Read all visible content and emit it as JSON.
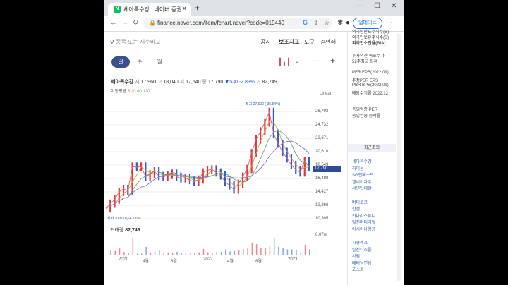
{
  "browser": {
    "tab_title": "세아특수강 : 네이버 증권",
    "url": "finance.naver.com/item/fchart.naver?code=019440",
    "update_label": "업데이트"
  },
  "chart_ui": {
    "search_placeholder": "종목 또는 지수비교",
    "menu": [
      "공시",
      "보조지표",
      "도구",
      "인쇄"
    ],
    "periods": [
      "일",
      "주",
      "월"
    ],
    "quote_name": "세아특수강",
    "quote_open_label": "시",
    "quote_open": "17,960",
    "quote_high_label": "고",
    "quote_high": "18,040",
    "quote_low_label": "저",
    "quote_low": "17,540",
    "quote_close_label": "종",
    "quote_close": "17,790",
    "quote_change": "▼530",
    "quote_pct": "-2.89%",
    "quote_vol_label": "거",
    "quote_vol": "82,749",
    "ma_label": "이동평균",
    "ma_values": [
      "5",
      "20",
      "60",
      "120"
    ],
    "scale": "Linear",
    "high_label": "최고 27,600 (-35.54%)",
    "low_label": "최저 10,800 (64.72%)",
    "current_price": "17,790",
    "volume_label": "거래량",
    "volume_value": "82,749",
    "volume_axis": "6.07m"
  },
  "chart_data": {
    "type": "line",
    "y_ticks": [
      "26,793",
      "24,732",
      "22,671",
      "20,610",
      "18,549",
      "16,488",
      "14,427",
      "12,366",
      "10,305"
    ],
    "x_ticks": [
      "2021",
      "4월",
      "8월",
      "2022",
      "4월",
      "8월",
      "2023"
    ],
    "price_series": [
      10.8,
      11.6,
      12.3,
      13.6,
      14.1,
      13.8,
      17.9,
      17.8,
      17.9,
      16.2,
      16.6,
      17.1,
      16.3,
      16.1,
      16.5,
      16.7,
      16.2,
      15.9,
      16.0,
      15.6,
      15.3,
      15.7,
      16.9,
      17.3,
      17.4,
      16.9,
      16.4,
      15.3,
      14.7,
      14.0,
      15.0,
      16.2,
      17.5,
      20.2,
      22.5,
      23.9,
      25.4,
      27.2,
      23.5,
      21.8,
      20.4,
      19.3,
      18.2,
      17.3,
      16.9,
      18.9,
      17.8
    ]
  },
  "sidebar": {
    "top_items": [
      "외국인한도주식수(B)",
      "외국인보유주식수(B)",
      "외국인소진율(B/A)"
    ],
    "rows1": [
      "투자의견 목표주가",
      "52주최고 최저"
    ],
    "rows2": [
      "PER EPS(2022.09)",
      "추정PER EPS",
      "PBR BPS(2022.09)",
      "배당수익률 2022.12"
    ],
    "rows3": [
      "동일업종 PER",
      "동일업종 등락률"
    ],
    "recent_header": "최근조회",
    "groups": [
      [
        "세아특수강",
        "하이론",
        "SG인베스트",
        "엠씨이차우",
        "서연탑메탈"
      ],
      [
        "버터로크",
        "한샘",
        "카다라스튜디",
        "일진머티리얼",
        "아시아나항공"
      ],
      [
        "시큐레크",
        "일진디스플",
        "서원",
        "베터닝연쉐",
        "포스코"
      ]
    ]
  }
}
